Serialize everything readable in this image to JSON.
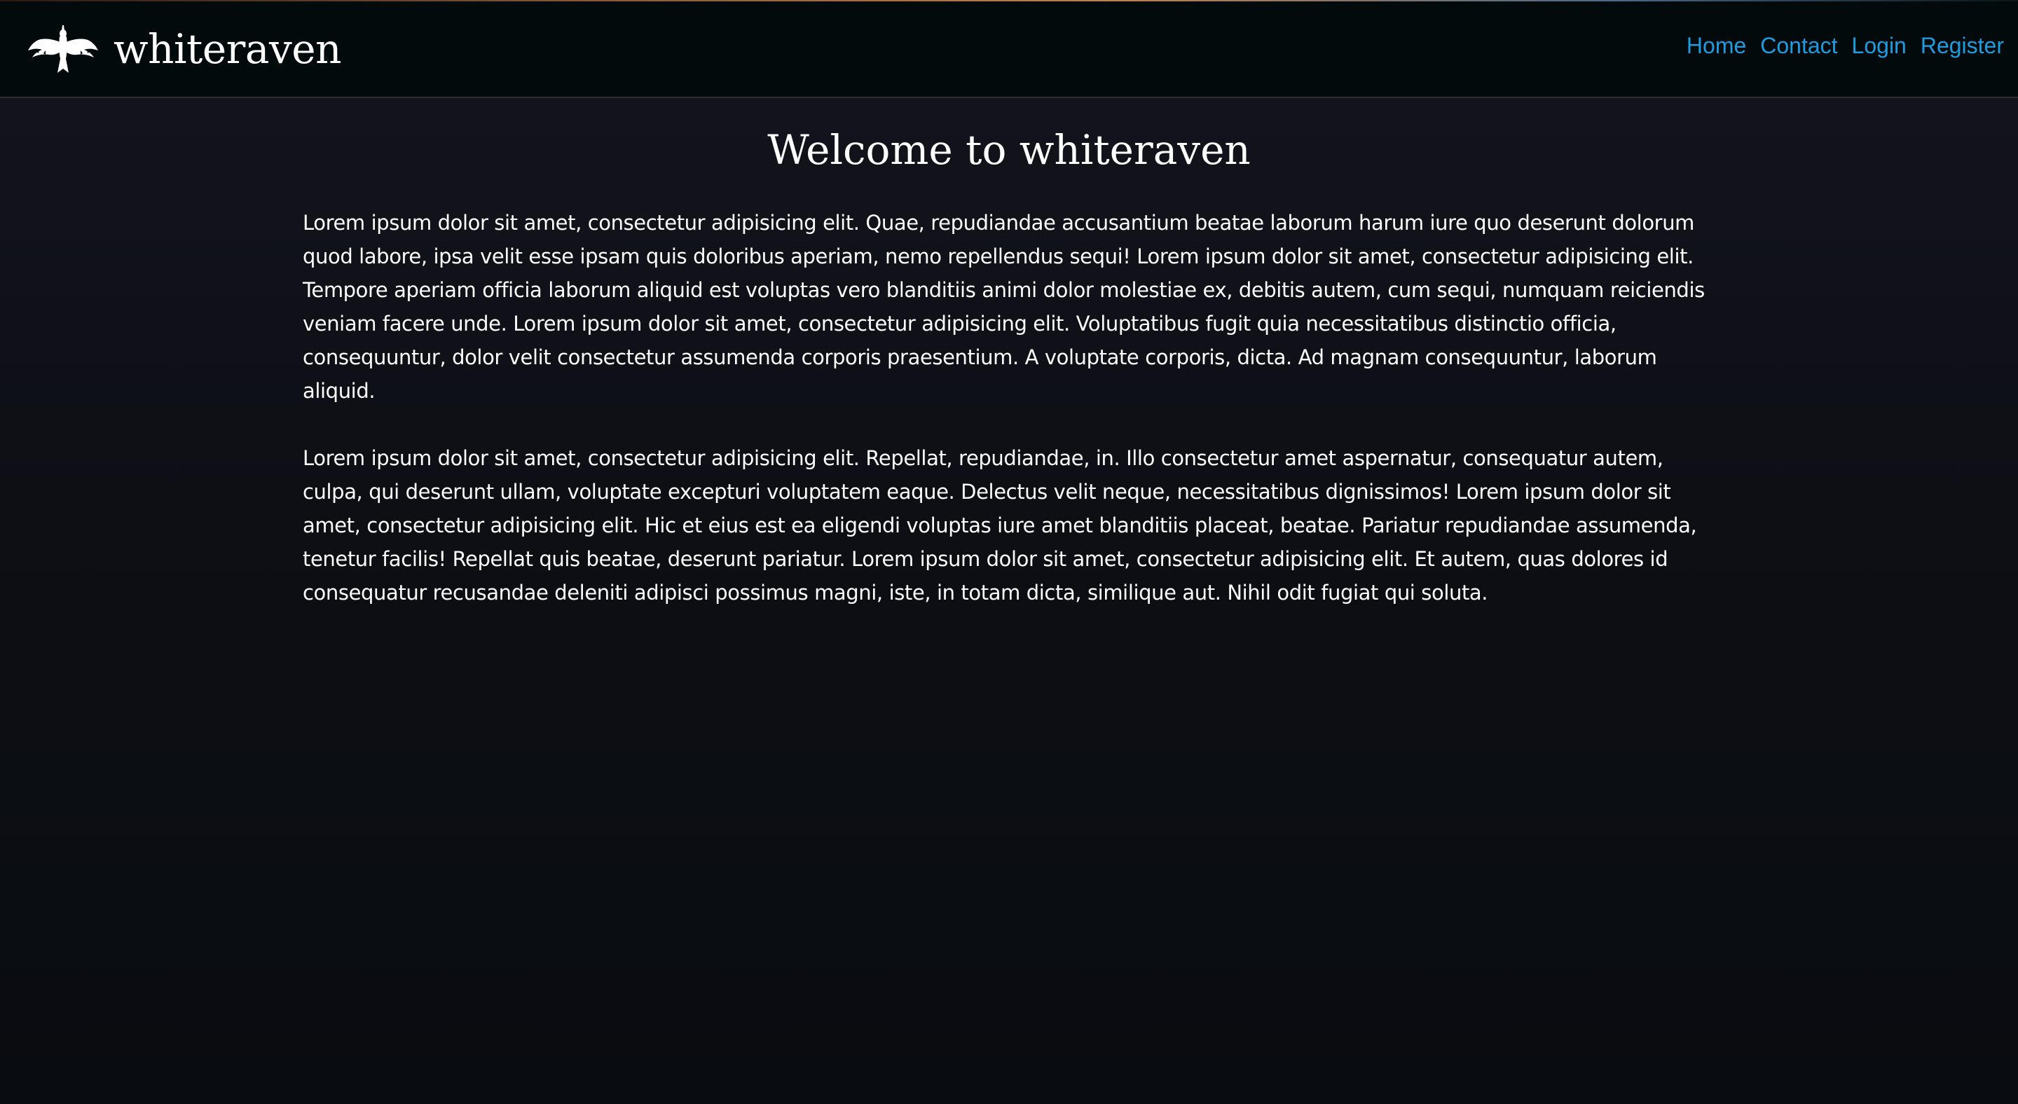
{
  "brand": {
    "name": "whiteraven",
    "logo_icon": "raven-silhouette-icon"
  },
  "nav": {
    "items": [
      {
        "label": "Home"
      },
      {
        "label": "Contact"
      },
      {
        "label": "Login"
      },
      {
        "label": "Register"
      }
    ],
    "link_color": "#1f9be0"
  },
  "main": {
    "title": "Welcome to whiteraven",
    "paragraphs": [
      "Lorem ipsum dolor sit amet, consectetur adipisicing elit. Quae, repudiandae accusantium beatae laborum harum iure quo deserunt dolorum quod labore, ipsa velit esse ipsam quis doloribus aperiam, nemo repellendus sequi! Lorem ipsum dolor sit amet, consectetur adipisicing elit. Tempore aperiam officia laborum aliquid est voluptas vero blanditiis animi dolor molestiae ex, debitis autem, cum sequi, numquam reiciendis veniam facere unde. Lorem ipsum dolor sit amet, consectetur adipisicing elit. Voluptatibus fugit quia necessitatibus distinctio officia, consequuntur, dolor velit consectetur assumenda corporis praesentium. A voluptate corporis, dicta. Ad magnam consequuntur, laborum aliquid.",
      "Lorem ipsum dolor sit amet, consectetur adipisicing elit. Repellat, repudiandae, in. Illo consectetur amet aspernatur, consequatur autem, culpa, qui deserunt ullam, voluptate excepturi voluptatem eaque. Delectus velit neque, necessitatibus dignissimos! Lorem ipsum dolor sit amet, consectetur adipisicing elit. Hic et eius est ea eligendi voluptas iure amet blanditiis placeat, beatae. Pariatur repudiandae assumenda, tenetur facilis! Repellat quis beatae, deserunt pariatur. Lorem ipsum dolor sit amet, consectetur adipisicing elit. Et autem, quas dolores id consequatur recusandae deleniti adipisci possimus magni, iste, in totam dicta, similique aut. Nihil odit fugiat qui soluta."
    ]
  },
  "colors": {
    "navbar_bg": "#030a0b",
    "page_bg": "#0d0f15",
    "text": "#ffffff"
  }
}
